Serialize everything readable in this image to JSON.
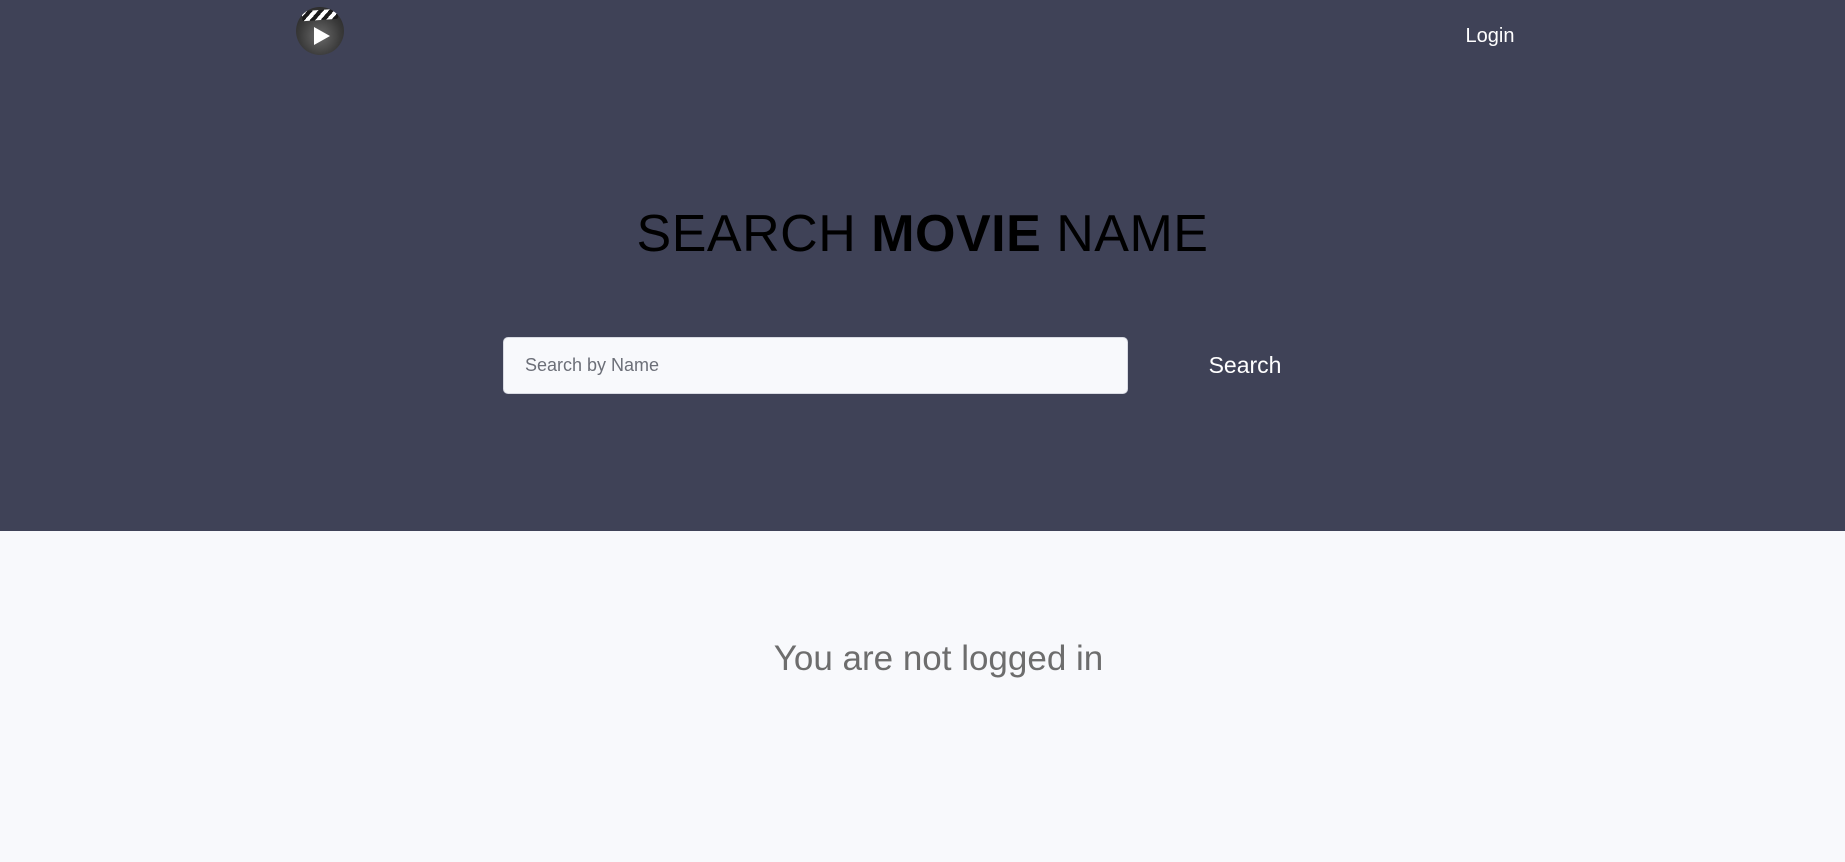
{
  "header": {
    "logo_icon": "movie-clapper-play-icon",
    "login_label": "Login"
  },
  "hero": {
    "title_prefix": "SEARCH ",
    "title_emphasis": "MOVIE",
    "title_suffix": " NAME",
    "search": {
      "value": "",
      "placeholder": "Search by Name",
      "button_label": "Search"
    }
  },
  "main": {
    "status_message": "You are not logged in"
  },
  "colors": {
    "hero_background": "#3f4257",
    "page_background": "#f8f9fc",
    "status_text": "#6d6d6d"
  }
}
